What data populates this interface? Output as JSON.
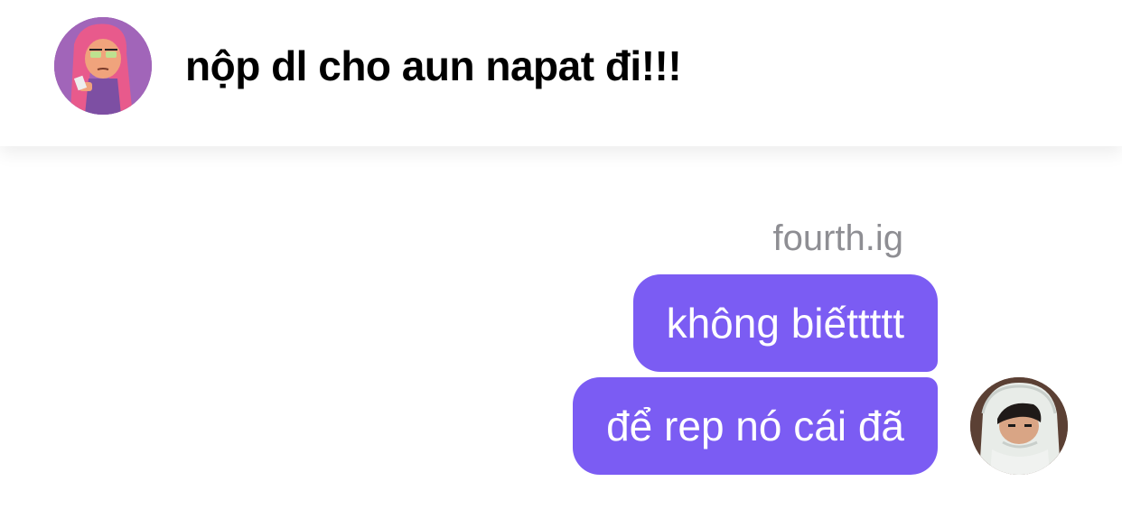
{
  "header": {
    "title": "nộp dl cho aun napat đi!!!",
    "avatar": {
      "icon": "cartoon-character-avatar",
      "bg_color": "#8c56a8"
    }
  },
  "thread": {
    "sender_name": "fourth.ig",
    "bubble_color": "#7b5cf3",
    "messages": [
      {
        "text": "không biếttttt"
      },
      {
        "text": "để rep nó cái đã"
      }
    ],
    "sender_avatar": {
      "icon": "user-photo-avatar"
    }
  }
}
